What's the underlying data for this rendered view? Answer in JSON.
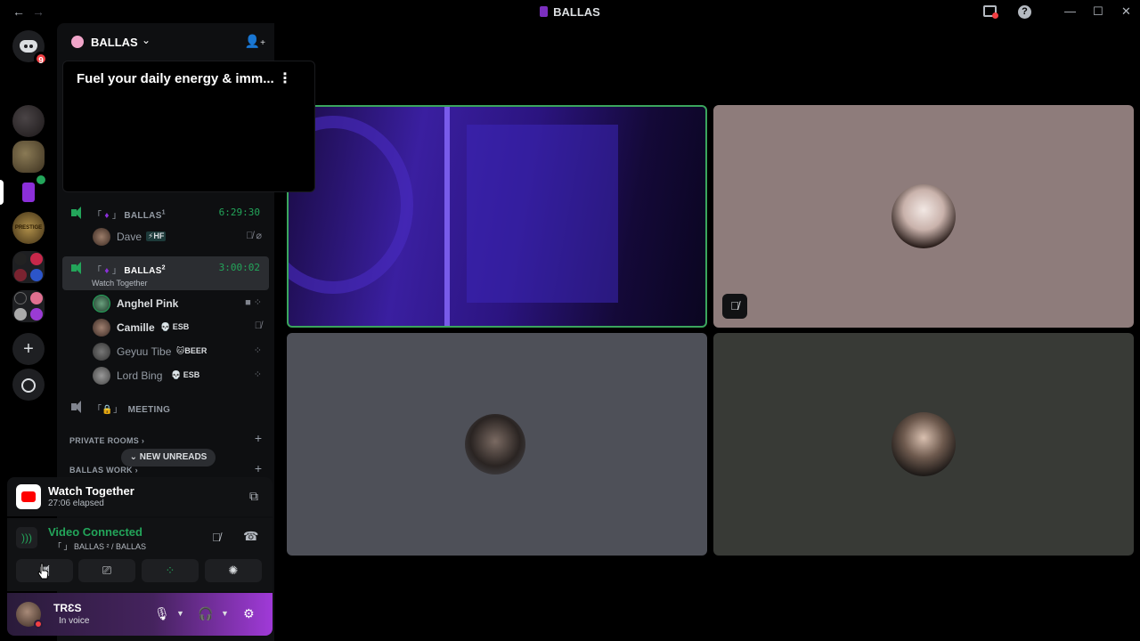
{
  "titlebar": {
    "back": "←",
    "forward": "→",
    "title": "BALLAS",
    "minimize": "—",
    "maximize": "☐",
    "close": "✕"
  },
  "rail": {
    "home_badge": "9",
    "prestige": "PRESTIGE",
    "add": "+"
  },
  "guild": {
    "name": "BALLAS",
    "chevron": "⌄",
    "invite_icon": "+"
  },
  "event": {
    "title": "Fuel your daily energy & imm...",
    "more": "⋮"
  },
  "channels": [
    {
      "open": "「",
      "close": "」",
      "name": "BALLAS",
      "sup": "1",
      "timer": "6:29:30"
    },
    {
      "open": "「",
      "close": "」",
      "name": "BALLAS",
      "sup": "2",
      "timer": "3:00:02",
      "sub": "Watch Together"
    },
    {
      "open": "「",
      "lock": "🔒",
      "close": "」",
      "name": "MEETING"
    }
  ],
  "voice_users_1": [
    {
      "name": "Dave",
      "tag": "⚡HF"
    }
  ],
  "voice_users_2": [
    {
      "name": "Anghel Pink",
      "tag": ""
    },
    {
      "name": "Camille",
      "tag": "💀 ESB"
    },
    {
      "name": "Geyuu Tibe",
      "tag": "🐱BEER"
    },
    {
      "name": "Lord Bing",
      "tag": "💀 ESB"
    }
  ],
  "categories": {
    "private": "PRIVATE ROOMS",
    "work": "BALLAS WORK",
    "chevron": "›",
    "plus": "+"
  },
  "new_unreads": "⌄ NEW UNREADS",
  "activity": {
    "title": "Watch Together",
    "elapsed": "27:06 elapsed"
  },
  "voice_panel": {
    "status": "Video Connected",
    "location": "「 」 BALLAS ² / BALLAS"
  },
  "user": {
    "name": "TRƐS",
    "state": "In voice"
  },
  "colors": {
    "accent_green": "#23a55a",
    "danger_red": "#f23f43",
    "brand_purple": "#8b2fd9"
  }
}
